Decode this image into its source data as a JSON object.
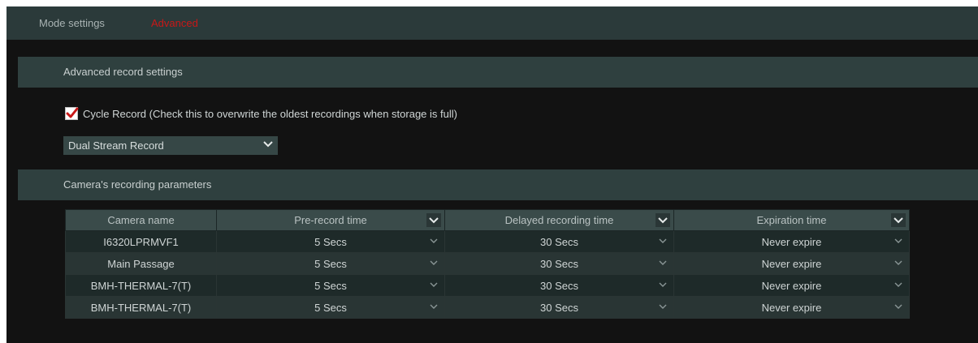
{
  "tabs": {
    "mode_settings": "Mode settings",
    "advanced": "Advanced"
  },
  "advanced_record": {
    "section_title": "Advanced record settings",
    "cycle_record_label": "Cycle Record (Check this to overwrite the oldest recordings when storage is full)",
    "cycle_record_checked": true,
    "stream_select_value": "Dual Stream Record"
  },
  "camera_params": {
    "section_title": "Camera's recording parameters",
    "columns": [
      "Camera name",
      "Pre-record time",
      "Delayed recording time",
      "Expiration time"
    ],
    "rows": [
      {
        "camera": "I6320LPRMVF1",
        "pre": "5 Secs",
        "delay": "30 Secs",
        "expire": "Never expire"
      },
      {
        "camera": "Main Passage",
        "pre": "5 Secs",
        "delay": "30 Secs",
        "expire": "Never expire"
      },
      {
        "camera": "BMH-THERMAL-7(T)",
        "pre": "5 Secs",
        "delay": "30 Secs",
        "expire": "Never expire"
      },
      {
        "camera": "BMH-THERMAL-7(T)",
        "pre": "5 Secs",
        "delay": "30 Secs",
        "expire": "Never expire"
      }
    ]
  },
  "colors": {
    "accent_active_tab": "#c81818",
    "checkbox_mark": "#c81818",
    "background": "#121212",
    "section_header": "#2f403f"
  },
  "icons": {
    "checkbox": "checkmark-icon",
    "dropdown": "chevron-down-icon"
  }
}
